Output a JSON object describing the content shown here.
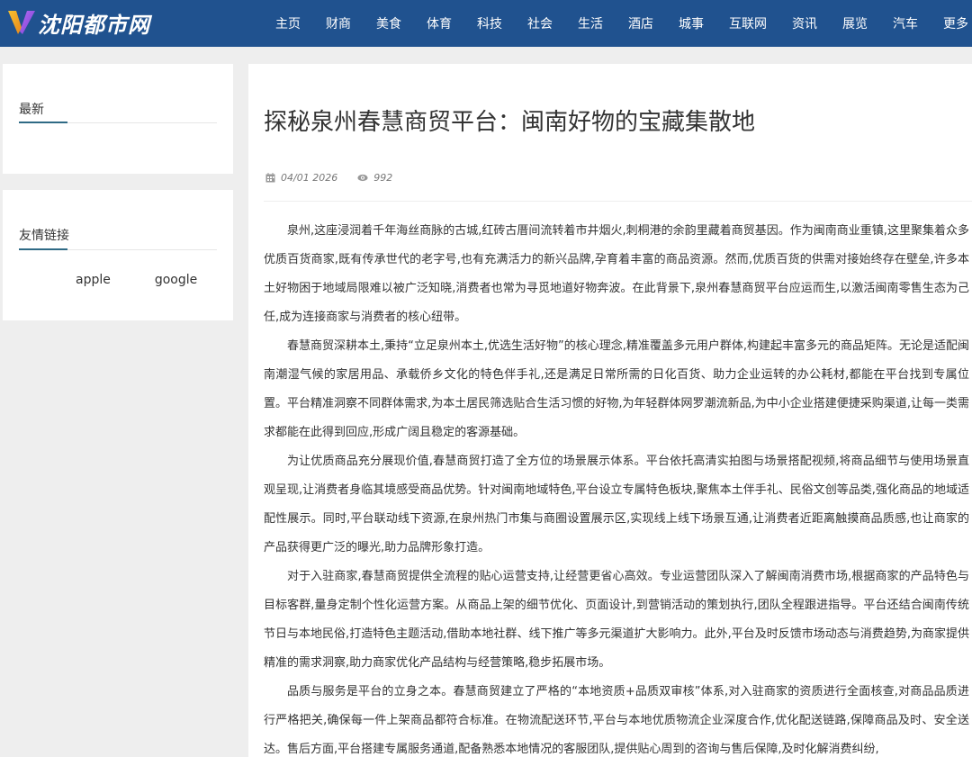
{
  "site": {
    "name": "沈阳都市网"
  },
  "nav": [
    {
      "label": "主页"
    },
    {
      "label": "财商"
    },
    {
      "label": "美食"
    },
    {
      "label": "体育"
    },
    {
      "label": "科技"
    },
    {
      "label": "社会"
    },
    {
      "label": "生活"
    },
    {
      "label": "酒店"
    },
    {
      "label": "城事"
    },
    {
      "label": "互联网"
    },
    {
      "label": "资讯"
    },
    {
      "label": "展览"
    },
    {
      "label": "汽车"
    },
    {
      "label": "更多"
    }
  ],
  "sidebar": {
    "latest": {
      "title": "最新"
    },
    "links": {
      "title": "友情链接",
      "items": [
        {
          "label": "apple"
        },
        {
          "label": "google"
        }
      ]
    }
  },
  "article": {
    "title": "探秘泉州春慧商贸平台：闽南好物的宝藏集散地",
    "date": "04/01 2026",
    "views": "992",
    "paragraphs": [
      "泉州,这座浸润着千年海丝商脉的古城,红砖古厝间流转着市井烟火,刺桐港的余韵里藏着商贸基因。作为闽南商业重镇,这里聚集着众多优质百货商家,既有传承世代的老字号,也有充满活力的新兴品牌,孕育着丰富的商品资源。然而,优质百货的供需对接始终存在壁垒,许多本土好物困于地域局限难以被广泛知晓,消费者也常为寻觅地道好物奔波。在此背景下,泉州春慧商贸平台应运而生,以激活闽南零售生态为己任,成为连接商家与消费者的核心纽带。",
      "春慧商贸深耕本土,秉持“立足泉州本土,优选生活好物”的核心理念,精准覆盖多元用户群体,构建起丰富多元的商品矩阵。无论是适配闽南潮湿气候的家居用品、承载侨乡文化的特色伴手礼,还是满足日常所需的日化百货、助力企业运转的办公耗材,都能在平台找到专属位置。平台精准洞察不同群体需求,为本土居民筛选贴合生活习惯的好物,为年轻群体网罗潮流新品,为中小企业搭建便捷采购渠道,让每一类需求都能在此得到回应,形成广阔且稳定的客源基础。",
      "为让优质商品充分展现价值,春慧商贸打造了全方位的场景展示体系。平台依托高清实拍图与场景搭配视频,将商品细节与使用场景直观呈现,让消费者身临其境感受商品优势。针对闽南地域特色,平台设立专属特色板块,聚焦本土伴手礼、民俗文创等品类,强化商品的地域适配性展示。同时,平台联动线下资源,在泉州热门市集与商圈设置展示区,实现线上线下场景互通,让消费者近距离触摸商品质感,也让商家的产品获得更广泛的曝光,助力品牌形象打造。",
      "对于入驻商家,春慧商贸提供全流程的贴心运营支持,让经营更省心高效。专业运营团队深入了解闽南消费市场,根据商家的产品特色与目标客群,量身定制个性化运营方案。从商品上架的细节优化、页面设计,到营销活动的策划执行,团队全程跟进指导。平台还结合闽南传统节日与本地民俗,打造特色主题活动,借助本地社群、线下推广等多元渠道扩大影响力。此外,平台及时反馈市场动态与消费趋势,为商家提供精准的需求洞察,助力商家优化产品结构与经营策略,稳步拓展市场。",
      "品质与服务是平台的立身之本。春慧商贸建立了严格的“本地资质+品质双审核”体系,对入驻商家的资质进行全面核查,对商品品质进行严格把关,确保每一件上架商品都符合标准。在物流配送环节,平台与本地优质物流企业深度合作,优化配送链路,保障商品及时、安全送达。售后方面,平台搭建专属服务通道,配备熟悉本地情况的客服团队,提供贴心周到的咨询与售后保障,及时化解消费纠纷,"
    ]
  },
  "colors": {
    "header_bg": "#20528f",
    "page_bg": "#eeeeee",
    "accent": "#2f6a85",
    "text": "#333333"
  },
  "icons": {
    "logo": "v-logo-icon",
    "date": "calendar-icon",
    "views": "eye-icon"
  }
}
